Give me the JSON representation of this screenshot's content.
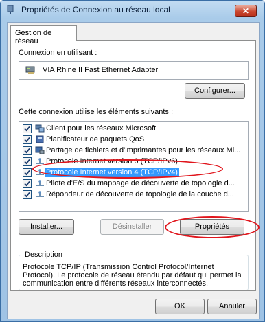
{
  "window": {
    "title": "Propriétés de Connexion au réseau local",
    "close_symbol": "✕"
  },
  "tabs": [
    {
      "label": "Gestion de réseau"
    }
  ],
  "connection": {
    "label": "Connexion en utilisant :",
    "adapter": "VIA Rhine II Fast Ethernet Adapter",
    "adapter_icon": "network-adapter-icon"
  },
  "buttons": {
    "configure": "Configurer...",
    "install": "Installer...",
    "uninstall": "Désinstaller",
    "properties": "Propriétés",
    "ok": "OK",
    "cancel": "Annuler"
  },
  "items_label": "Cette connexion utilise les éléments suivants :",
  "items": [
    {
      "label": "Client pour les réseaux Microsoft",
      "checked": true,
      "icon": "network-client-icon"
    },
    {
      "label": "Planificateur de paquets QoS",
      "checked": true,
      "icon": "qos-scheduler-icon"
    },
    {
      "label": "Partage de fichiers et d'imprimantes pour les réseaux Mi...",
      "checked": true,
      "icon": "file-sharing-icon"
    },
    {
      "label": "Protocole Internet version 6 (TCP/IPv6)",
      "checked": true,
      "icon": "protocol-icon"
    },
    {
      "label": "Protocole Internet version 4 (TCP/IPv4)",
      "checked": true,
      "icon": "protocol-icon",
      "selected": true
    },
    {
      "label": "Pilote d'E/S du mappage de découverte de topologie d...",
      "checked": true,
      "icon": "protocol-icon"
    },
    {
      "label": "Répondeur de découverte de topologie de la couche d...",
      "checked": true,
      "icon": "protocol-icon"
    }
  ],
  "description": {
    "title": "Description",
    "text": "Protocole TCP/IP (Transmission Control Protocol/Internet Protocol). Le protocole de réseau étendu par défaut qui permet la communication entre différents réseaux interconnectés."
  },
  "colors": {
    "selection": "#3399ff",
    "annotation": "#e0151c",
    "title_close": "#c9452d"
  }
}
